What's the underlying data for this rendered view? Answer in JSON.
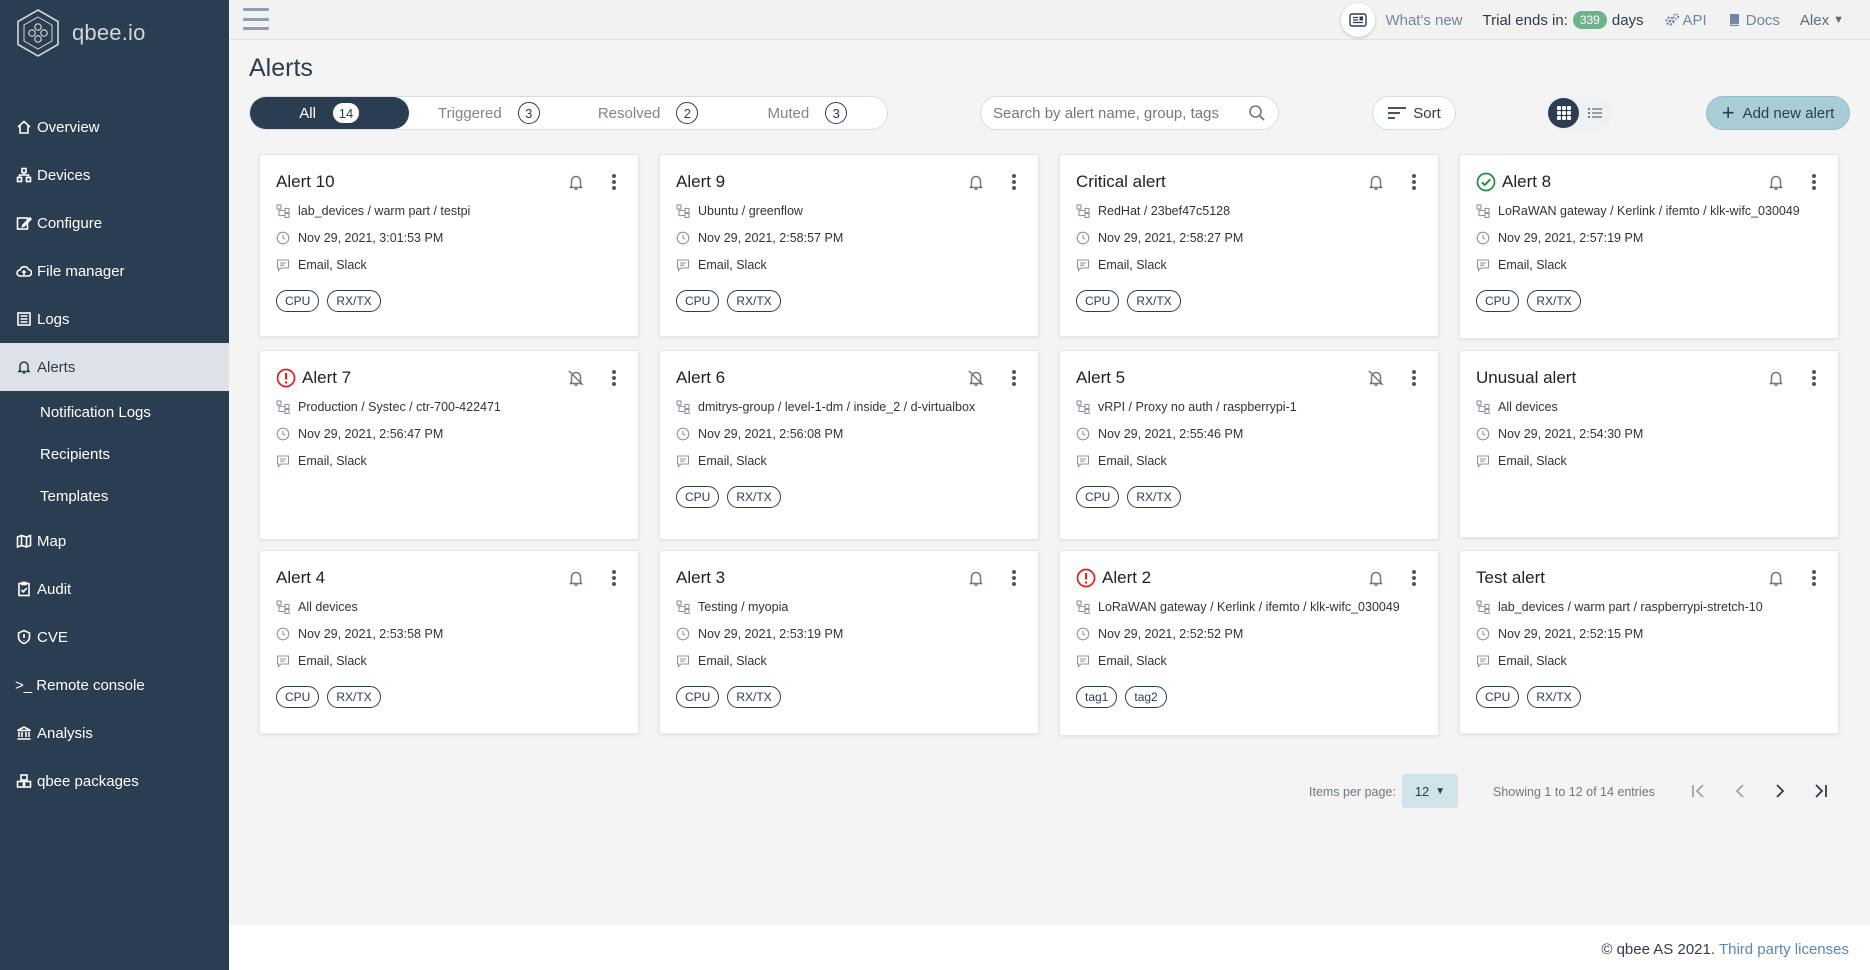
{
  "app": {
    "logo_text": "qbee.io"
  },
  "sidebar": {
    "items": [
      {
        "label": "Overview",
        "icon": "home-icon"
      },
      {
        "label": "Devices",
        "icon": "devices-icon"
      },
      {
        "label": "Configure",
        "icon": "edit-icon"
      },
      {
        "label": "File manager",
        "icon": "cloud-upload-icon"
      },
      {
        "label": "Logs",
        "icon": "logs-icon"
      },
      {
        "label": "Alerts",
        "icon": "bell-icon"
      },
      {
        "label": "Map",
        "icon": "map-icon"
      },
      {
        "label": "Audit",
        "icon": "clipboard-icon"
      },
      {
        "label": "CVE",
        "icon": "cve-icon"
      },
      {
        "label": ">_ Remote console",
        "icon": "terminal-icon"
      },
      {
        "label": "Analysis",
        "icon": "bank-icon"
      },
      {
        "label": "qbee packages",
        "icon": "packages-icon"
      }
    ],
    "sub_items": [
      {
        "label": "Notification Logs"
      },
      {
        "label": "Recipients"
      },
      {
        "label": "Templates"
      }
    ]
  },
  "topbar": {
    "whats_new": "What's new",
    "trial_prefix": "Trial ends in:",
    "trial_days": "339",
    "trial_suffix": "days",
    "api": "API",
    "docs": "Docs",
    "user": "Alex"
  },
  "page": {
    "title": "Alerts"
  },
  "filters": [
    {
      "label": "All",
      "count": "14",
      "active": true
    },
    {
      "label": "Triggered",
      "count": "3"
    },
    {
      "label": "Resolved",
      "count": "2"
    },
    {
      "label": "Muted",
      "count": "3"
    }
  ],
  "search": {
    "placeholder": "Search by alert name, group, tags"
  },
  "sort_label": "Sort",
  "add_label": "Add new alert",
  "cards": [
    {
      "title": "Alert 10",
      "status": "",
      "muted": false,
      "target": "lab_devices / warm part / testpi",
      "time": "Nov 29, 2021, 3:01:53 PM",
      "channels": "Email, Slack",
      "tags": [
        "CPU",
        "RX/TX"
      ]
    },
    {
      "title": "Alert 9",
      "status": "",
      "muted": false,
      "target": "Ubuntu / greenflow",
      "time": "Nov 29, 2021, 2:58:57 PM",
      "channels": "Email, Slack",
      "tags": [
        "CPU",
        "RX/TX"
      ]
    },
    {
      "title": "Critical alert",
      "status": "",
      "muted": false,
      "target": "RedHat / 23bef47c5128",
      "time": "Nov 29, 2021, 2:58:27 PM",
      "channels": "Email, Slack",
      "tags": [
        "CPU",
        "RX/TX"
      ]
    },
    {
      "title": "Alert 8",
      "status": "resolved",
      "muted": false,
      "target": "LoRaWAN gateway / Kerlink / ifemto / klk-wifc_030049",
      "time": "Nov 29, 2021, 2:57:19 PM",
      "channels": "Email, Slack",
      "tags": [
        "CPU",
        "RX/TX"
      ]
    },
    {
      "title": "Alert 7",
      "status": "triggered",
      "muted": true,
      "target": "Production / Systec / ctr-700-422471",
      "time": "Nov 29, 2021, 2:56:47 PM",
      "channels": "Email, Slack",
      "tags": []
    },
    {
      "title": "Alert 6",
      "status": "",
      "muted": true,
      "target": "dmitrys-group / level-1-dm / inside_2 / d-virtualbox",
      "time": "Nov 29, 2021, 2:56:08 PM",
      "channels": "Email, Slack",
      "tags": [
        "CPU",
        "RX/TX"
      ]
    },
    {
      "title": "Alert 5",
      "status": "",
      "muted": true,
      "target": "vRPI / Proxy no auth / raspberrypi-1",
      "time": "Nov 29, 2021, 2:55:46 PM",
      "channels": "Email, Slack",
      "tags": [
        "CPU",
        "RX/TX"
      ]
    },
    {
      "title": "Unusual alert",
      "status": "",
      "muted": false,
      "target": "All devices",
      "time": "Nov 29, 2021, 2:54:30 PM",
      "channels": "Email, Slack",
      "tags": []
    },
    {
      "title": "Alert 4",
      "status": "",
      "muted": false,
      "target": "All devices",
      "time": "Nov 29, 2021, 2:53:58 PM",
      "channels": "Email, Slack",
      "tags": [
        "CPU",
        "RX/TX"
      ]
    },
    {
      "title": "Alert 3",
      "status": "",
      "muted": false,
      "target": "Testing / myopia",
      "time": "Nov 29, 2021, 2:53:19 PM",
      "channels": "Email, Slack",
      "tags": [
        "CPU",
        "RX/TX"
      ]
    },
    {
      "title": "Alert 2",
      "status": "triggered",
      "muted": false,
      "target": "LoRaWAN gateway / Kerlink / ifemto / klk-wifc_030049",
      "time": "Nov 29, 2021, 2:52:52 PM",
      "channels": "Email, Slack",
      "tags": [
        "tag1",
        "tag2"
      ]
    },
    {
      "title": "Test alert",
      "status": "",
      "muted": false,
      "target": "lab_devices / warm part / raspberrypi-stretch-10",
      "time": "Nov 29, 2021, 2:52:15 PM",
      "channels": "Email, Slack",
      "tags": [
        "CPU",
        "RX/TX"
      ]
    }
  ],
  "pagination": {
    "items_per_page_label": "Items per page:",
    "items_per_page": "12",
    "showing": "Showing 1 to 12 of 14 entries"
  },
  "footer": {
    "copyright": "© qbee AS 2021.",
    "link": "Third party licenses"
  },
  "colors": {
    "sidebar": "#2b3d50",
    "accent": "#a8cdd6",
    "triggered": "#e02020",
    "resolved": "#1f8f3a",
    "trial_badge": "#6fb38a"
  }
}
